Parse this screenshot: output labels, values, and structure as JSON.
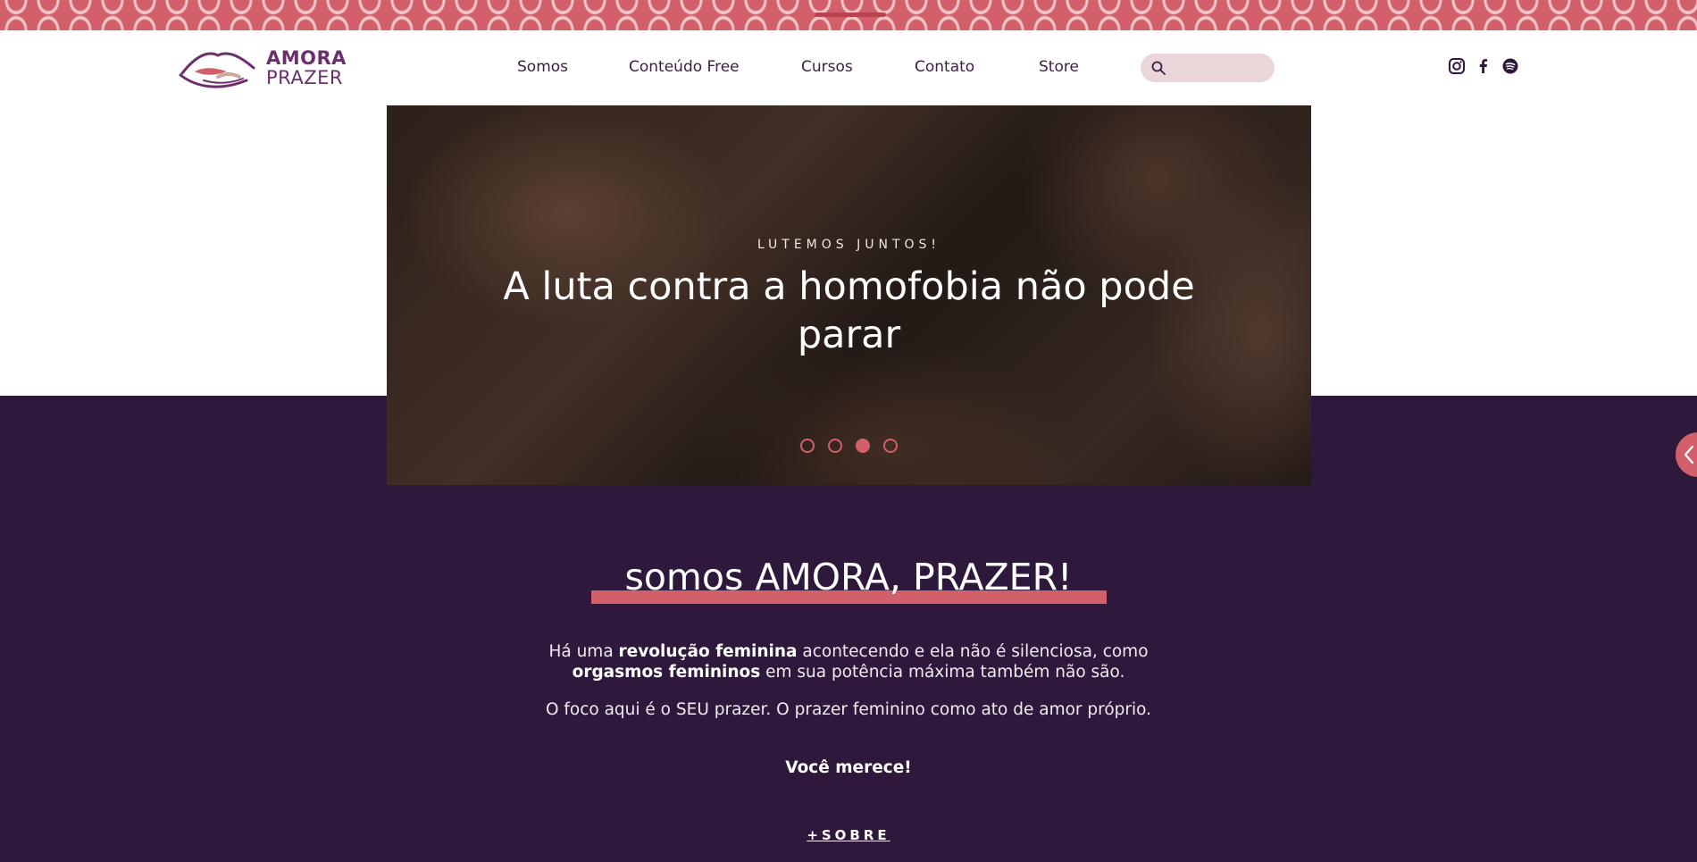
{
  "brand": {
    "line1": "AMORA",
    "line2": "PRAZER",
    "color": "#6b2f6d"
  },
  "nav": {
    "items": [
      {
        "label": "Somos"
      },
      {
        "label": "Conteúdo Free"
      },
      {
        "label": "Cursos"
      },
      {
        "label": "Contato"
      },
      {
        "label": "Store"
      }
    ]
  },
  "search": {
    "placeholder": "",
    "value": ""
  },
  "social": {
    "icons": [
      "instagram-icon",
      "facebook-icon",
      "spotify-icon"
    ]
  },
  "hero": {
    "eyebrow": "LUTEMOS JUNTOS!",
    "title": "A luta contra a homofobia não pode parar",
    "slides_total": 4,
    "active_slide": 3
  },
  "about": {
    "title": "somos AMORA, PRAZER!",
    "p1_prefix": "Há uma ",
    "p1_bold1": "revolução feminina",
    "p1_mid": " acontecendo e ela não é silenciosa, como ",
    "p1_bold2": "orgasmos femininos",
    "p1_suffix": " em sua potência máxima também não são.",
    "p2": "O foco aqui é o SEU prazer. O prazer feminino como ato de amor próprio.",
    "p3": "Você merece!",
    "link": "+SOBRE"
  },
  "colors": {
    "accent": "#d2606b",
    "dark_purple": "#2e183c",
    "nav_text": "#3d1d42",
    "search_bg": "#ead6d9"
  }
}
